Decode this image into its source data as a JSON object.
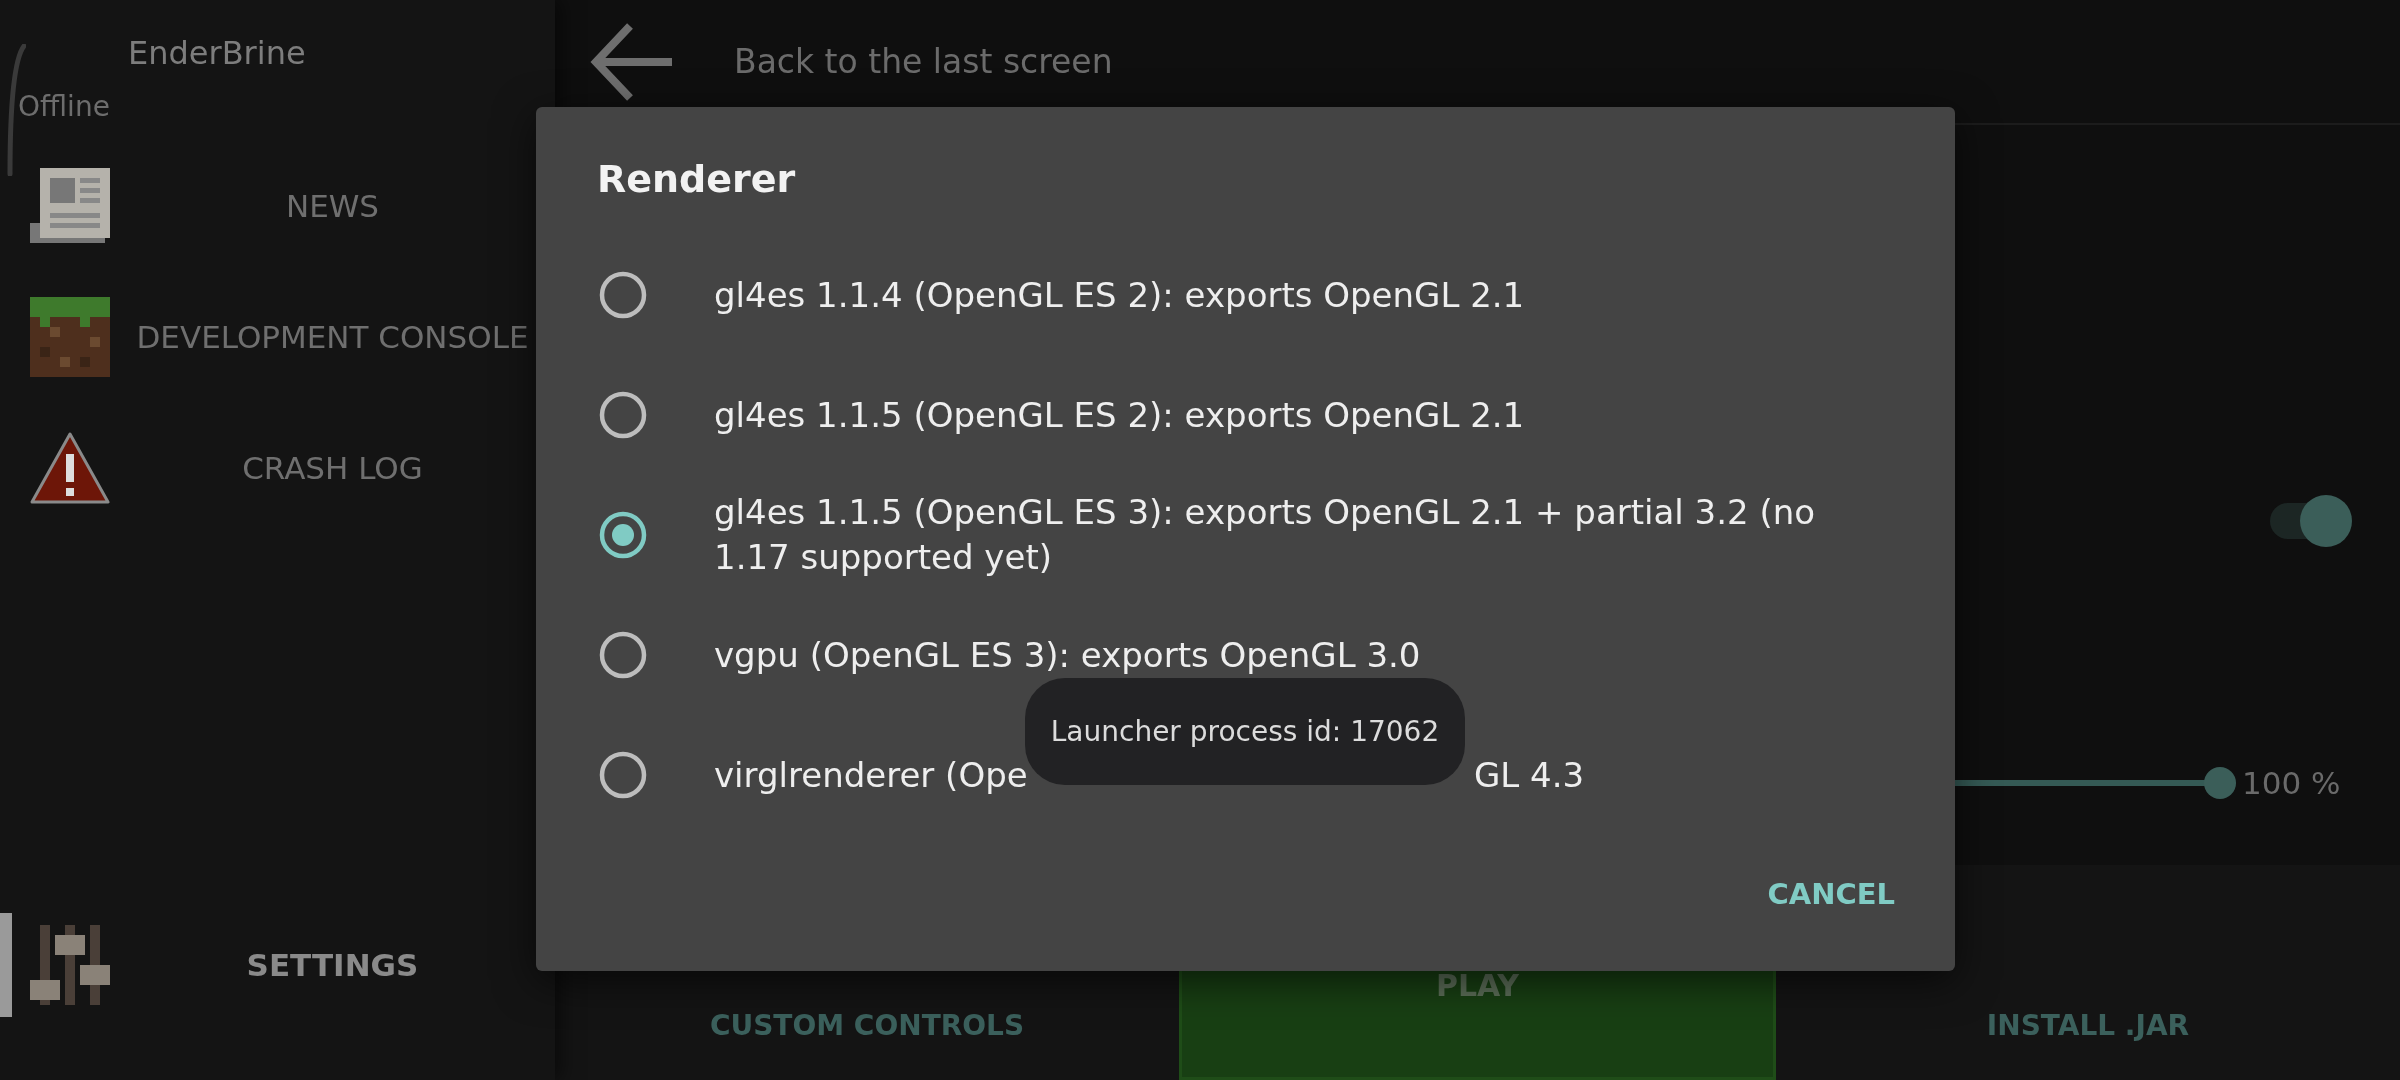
{
  "sidebar": {
    "account": {
      "name": "EnderBrine",
      "status": "Offline"
    },
    "items": [
      {
        "kind": "news",
        "label": "NEWS",
        "selected": false
      },
      {
        "kind": "console",
        "label": "DEVELOPMENT CONSOLE",
        "selected": false
      },
      {
        "kind": "crash",
        "label": "CRASH LOG",
        "selected": false
      }
    ],
    "settings": {
      "label": "SETTINGS",
      "selected": true
    }
  },
  "top_bar": {
    "title": "Back to the last screen"
  },
  "settings_panel": {
    "toggle": {
      "on": true
    },
    "slider": {
      "level": 1,
      "reading": "100 %"
    }
  },
  "bottom_bar": {
    "custom_controls": "CUSTOM CONTROLS",
    "play": "PLAY",
    "install_jar": "INSTALL .JAR"
  },
  "dialog": {
    "title": "Renderer",
    "options": [
      {
        "label": "gl4es 1.1.4 (OpenGL ES 2): exports OpenGL 2.1",
        "selected": false
      },
      {
        "label": "gl4es 1.1.5 (OpenGL ES 2): exports OpenGL 2.1",
        "selected": false
      },
      {
        "label": "gl4es 1.1.5 (OpenGL ES 3): exports OpenGL 2.1 + partial 3.2 (no 1.17 supported yet)",
        "selected": true
      },
      {
        "label": "vgpu (OpenGL ES 3): exports OpenGL 3.0",
        "selected": false
      },
      {
        "label": "virglrenderer (Ope",
        "label_end": "GL 4.3",
        "selected": false
      }
    ],
    "cancel": "CANCEL"
  },
  "toast": {
    "text": "Launcher process id: 17062"
  }
}
